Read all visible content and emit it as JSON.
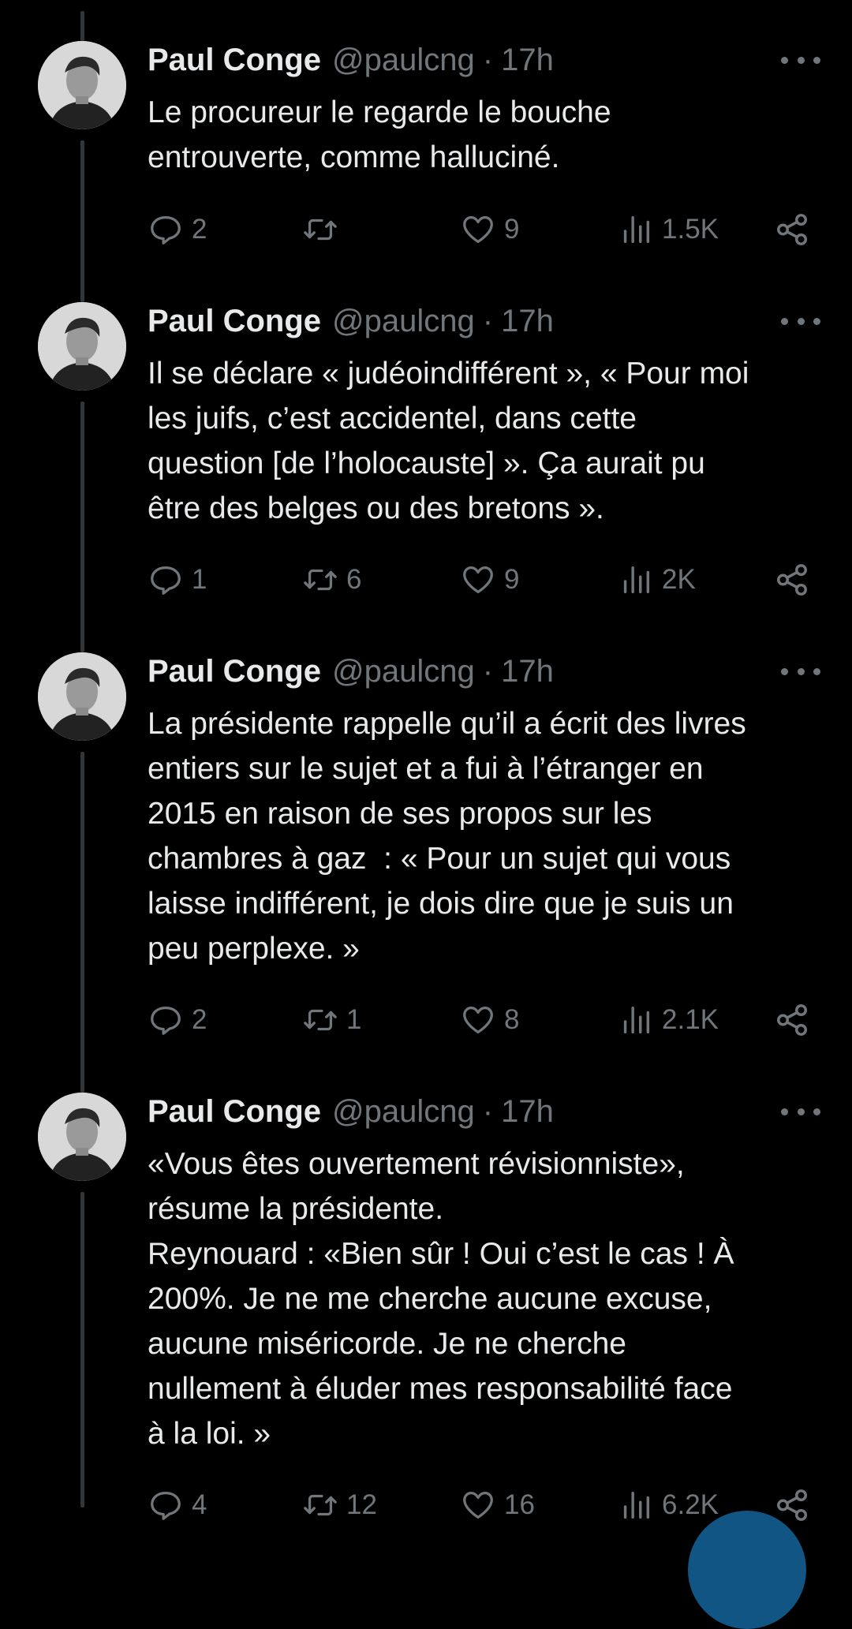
{
  "tweets": [
    {
      "author": "Paul Conge",
      "handle": "@paulcng",
      "separator": "·",
      "time": "17h",
      "text": "Le procureur le regarde le bouche\nentrouverte, comme halluciné.",
      "replies": "2",
      "retweets": "",
      "likes": "9",
      "views": "1.5K"
    },
    {
      "author": "Paul Conge",
      "handle": "@paulcng",
      "separator": "·",
      "time": "17h",
      "text": "Il se déclare « judéoindifférent », « Pour moi\nles juifs, c’est accidentel, dans cette\nquestion [de l’holocauste] ». Ça aurait pu\nêtre des belges ou des bretons ».",
      "replies": "1",
      "retweets": "6",
      "likes": "9",
      "views": "2K"
    },
    {
      "author": "Paul Conge",
      "handle": "@paulcng",
      "separator": "·",
      "time": "17h",
      "text": "La présidente rappelle qu’il a écrit des livres\nentiers sur le sujet et a fui à l’étranger en\n2015 en raison de ses propos sur les\nchambres à gaz  : « Pour un sujet qui vous\nlaisse indifférent, je dois dire que je suis un\npeu perplexe. »",
      "replies": "2",
      "retweets": "1",
      "likes": "8",
      "views": "2.1K"
    },
    {
      "author": "Paul Conge",
      "handle": "@paulcng",
      "separator": "·",
      "time": "17h",
      "text": "«Vous êtes ouvertement révisionniste»,\nrésume la présidente.\nReynouard : «Bien sûr ! Oui c’est le cas ! À\n200%. Je ne me cherche aucune excuse,\naucune miséricorde. Je ne cherche\nnullement à éluder mes responsabilité face\nà la loi. »",
      "replies": "4",
      "retweets": "12",
      "likes": "16",
      "views": "6.2K"
    }
  ],
  "icons": {
    "reply": "reply-icon",
    "retweet": "retweet-icon",
    "like": "heart-icon",
    "views": "views-icon",
    "share": "share-icon",
    "more": "more-icon"
  },
  "colors": {
    "background": "#000000",
    "text": "#e7e9ea",
    "secondary": "#71767b",
    "thread_line": "#333639",
    "accent": "#1d9bf0"
  }
}
